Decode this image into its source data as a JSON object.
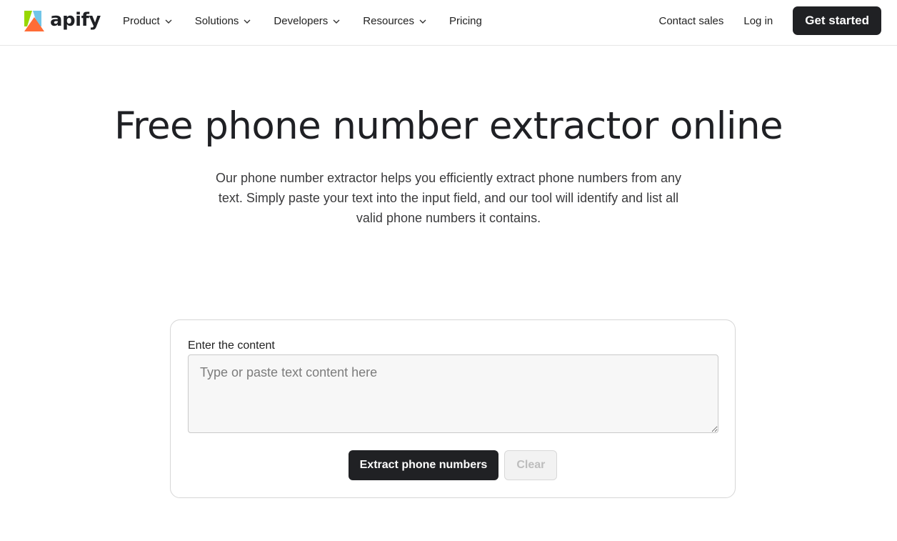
{
  "brand": {
    "name": "apify",
    "colors": {
      "green": "#97d700",
      "blue": "#71c5e8",
      "orange": "#ff6c37",
      "dark": "#1f2024"
    }
  },
  "nav": {
    "items": [
      {
        "label": "Product",
        "has_dropdown": true
      },
      {
        "label": "Solutions",
        "has_dropdown": true
      },
      {
        "label": "Developers",
        "has_dropdown": true
      },
      {
        "label": "Resources",
        "has_dropdown": true
      },
      {
        "label": "Pricing",
        "has_dropdown": false
      }
    ],
    "contact_sales": "Contact sales",
    "login": "Log in",
    "get_started": "Get started"
  },
  "hero": {
    "title": "Free phone number extractor online",
    "subtitle": "Our phone number extractor helps you efficiently extract phone numbers from any text. Simply paste your text into the input field, and our tool will identify and list all valid phone numbers it contains."
  },
  "tool": {
    "label": "Enter the content",
    "input_value": "",
    "placeholder": "Type or paste text content here",
    "extract_button": "Extract phone numbers",
    "clear_button": "Clear",
    "clear_disabled": true
  },
  "icons": {
    "logo": "apify-logo-icon",
    "dropdown": "chevron-down-icon"
  }
}
